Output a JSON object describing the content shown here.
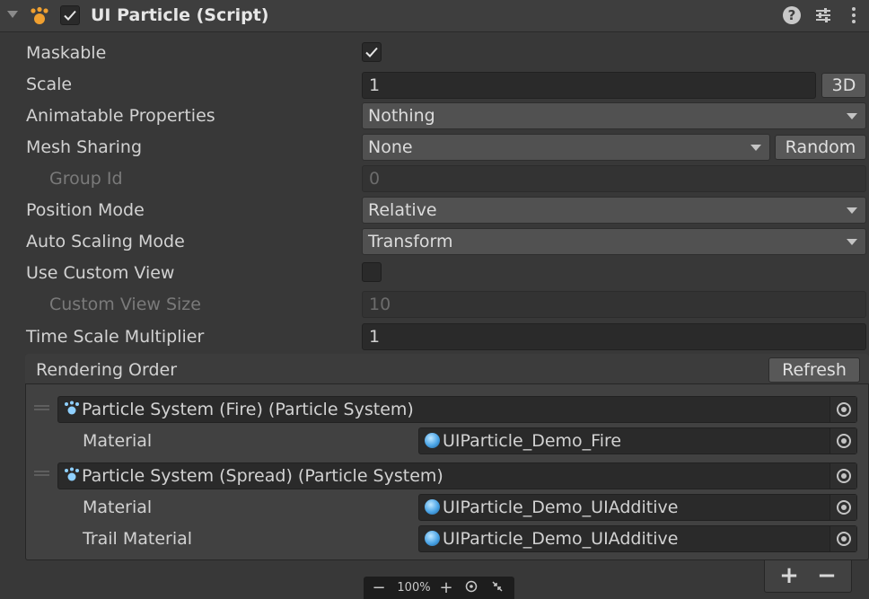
{
  "component": {
    "title": "UI Particle (Script)",
    "enabled": true,
    "icons": [
      "component-particle-icon",
      "help-icon",
      "presets-icon",
      "more-menu-icon"
    ]
  },
  "properties": {
    "maskable": {
      "label": "Maskable",
      "checked": true
    },
    "scale": {
      "label": "Scale",
      "value": "1",
      "button": "3D"
    },
    "animatable_properties": {
      "label": "Animatable Properties",
      "value": "Nothing"
    },
    "mesh_sharing": {
      "label": "Mesh Sharing",
      "value": "None",
      "button": "Random"
    },
    "group_id": {
      "label": "Group Id",
      "value": "0"
    },
    "position_mode": {
      "label": "Position Mode",
      "value": "Relative"
    },
    "auto_scaling_mode": {
      "label": "Auto Scaling Mode",
      "value": "Transform"
    },
    "use_custom_view": {
      "label": "Use Custom View",
      "checked": false
    },
    "custom_view_size": {
      "label": "Custom View Size",
      "value": "10"
    },
    "time_scale_multiplier": {
      "label": "Time Scale Multiplier",
      "value": "1"
    }
  },
  "rendering_order": {
    "title": "Rendering Order",
    "refresh_label": "Refresh",
    "items": [
      {
        "system": "Particle System (Fire) (Particle System)",
        "materials": [
          {
            "label": "Material",
            "value": "UIParticle_Demo_Fire"
          }
        ]
      },
      {
        "system": "Particle System (Spread) (Particle System)",
        "materials": [
          {
            "label": "Material",
            "value": "UIParticle_Demo_UIAdditive"
          },
          {
            "label": "Trail Material",
            "value": "UIParticle_Demo_UIAdditive"
          }
        ]
      }
    ],
    "add_label": "+",
    "remove_label": "−"
  },
  "zoom": {
    "minus": "−",
    "level": "100%",
    "plus": "+"
  },
  "colors": {
    "background": "#383838",
    "field": "#2a2a2a",
    "dropdown": "#515151",
    "accent_particle": "#8fd0ff",
    "component_icon": "#f0a030"
  }
}
